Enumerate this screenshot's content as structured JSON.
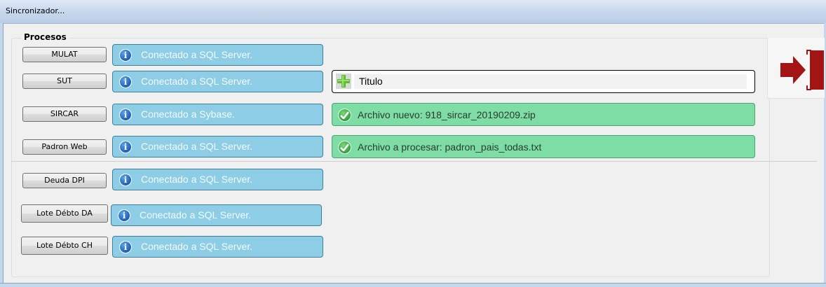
{
  "window": {
    "title": "Sincronizador..."
  },
  "group": {
    "title": "Procesos"
  },
  "processes": [
    {
      "label": "MULAT",
      "status": "Conectado a SQL Server."
    },
    {
      "label": "SUT",
      "status": "Conectado a SQL Server."
    },
    {
      "label": "SIRCAR",
      "status": "Conectado a Sybase."
    },
    {
      "label": "Padron Web",
      "status": "Conectado a SQL Server."
    },
    {
      "label": "Deuda DPI",
      "status": "Conectado a SQL Server."
    },
    {
      "label": "Lote Débto DA",
      "status": "Conectado a SQL Server."
    },
    {
      "label": "Lote Débto CH",
      "status": "Conectado a SQL Server."
    }
  ],
  "messages": {
    "title_box": {
      "text": "Titulo",
      "icon": "plus-icon"
    },
    "sircar": {
      "text": "Archivo nuevo: 918_sircar_20190209.zip",
      "icon": "check-icon"
    },
    "padron": {
      "text": "Archivo a procesar: padron_pais_todas.txt",
      "icon": "check-icon"
    }
  },
  "exit": {
    "icon": "exit-door-icon"
  },
  "colors": {
    "status_bg": "#8dcde6",
    "success_bg": "#7ddda4",
    "exit_red": "#a31515"
  }
}
